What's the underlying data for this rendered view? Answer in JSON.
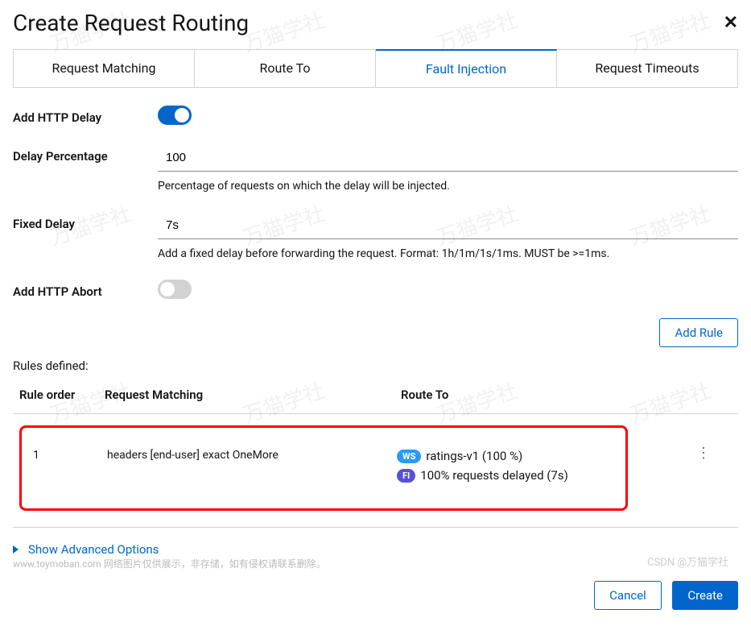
{
  "header": {
    "title": "Create Request Routing"
  },
  "tabs": [
    "Request Matching",
    "Route To",
    "Fault Injection",
    "Request Timeouts"
  ],
  "active_tab": 2,
  "form": {
    "add_delay_label": "Add HTTP Delay",
    "add_delay_on": true,
    "delay_pct_label": "Delay Percentage",
    "delay_pct_value": "100",
    "delay_pct_help": "Percentage of requests on which the delay will be injected.",
    "fixed_delay_label": "Fixed Delay",
    "fixed_delay_value": "7s",
    "fixed_delay_help": "Add a fixed delay before forwarding the request. Format: 1h/1m/1s/1ms. MUST be >=1ms.",
    "add_abort_label": "Add HTTP Abort",
    "add_abort_on": false
  },
  "buttons": {
    "add_rule": "Add Rule",
    "cancel": "Cancel",
    "create": "Create",
    "advanced": "Show Advanced Options"
  },
  "rules": {
    "title": "Rules defined:",
    "headers": {
      "order": "Rule order",
      "match": "Request Matching",
      "route": "Route To"
    },
    "rows": [
      {
        "order": "1",
        "match": "headers [end-user] exact OneMore",
        "badges": {
          "ws": "WS",
          "fi": "FI"
        },
        "route_ws": "ratings-v1 (100 %)",
        "route_fi": "100% requests delayed (7s)"
      }
    ]
  },
  "footnote": "www.toymoban.com 网络图片仅供展示，非存储，如有侵权请联系删除。",
  "csdn": "CSDN @万猫学社",
  "watermark_text": "万猫学社"
}
